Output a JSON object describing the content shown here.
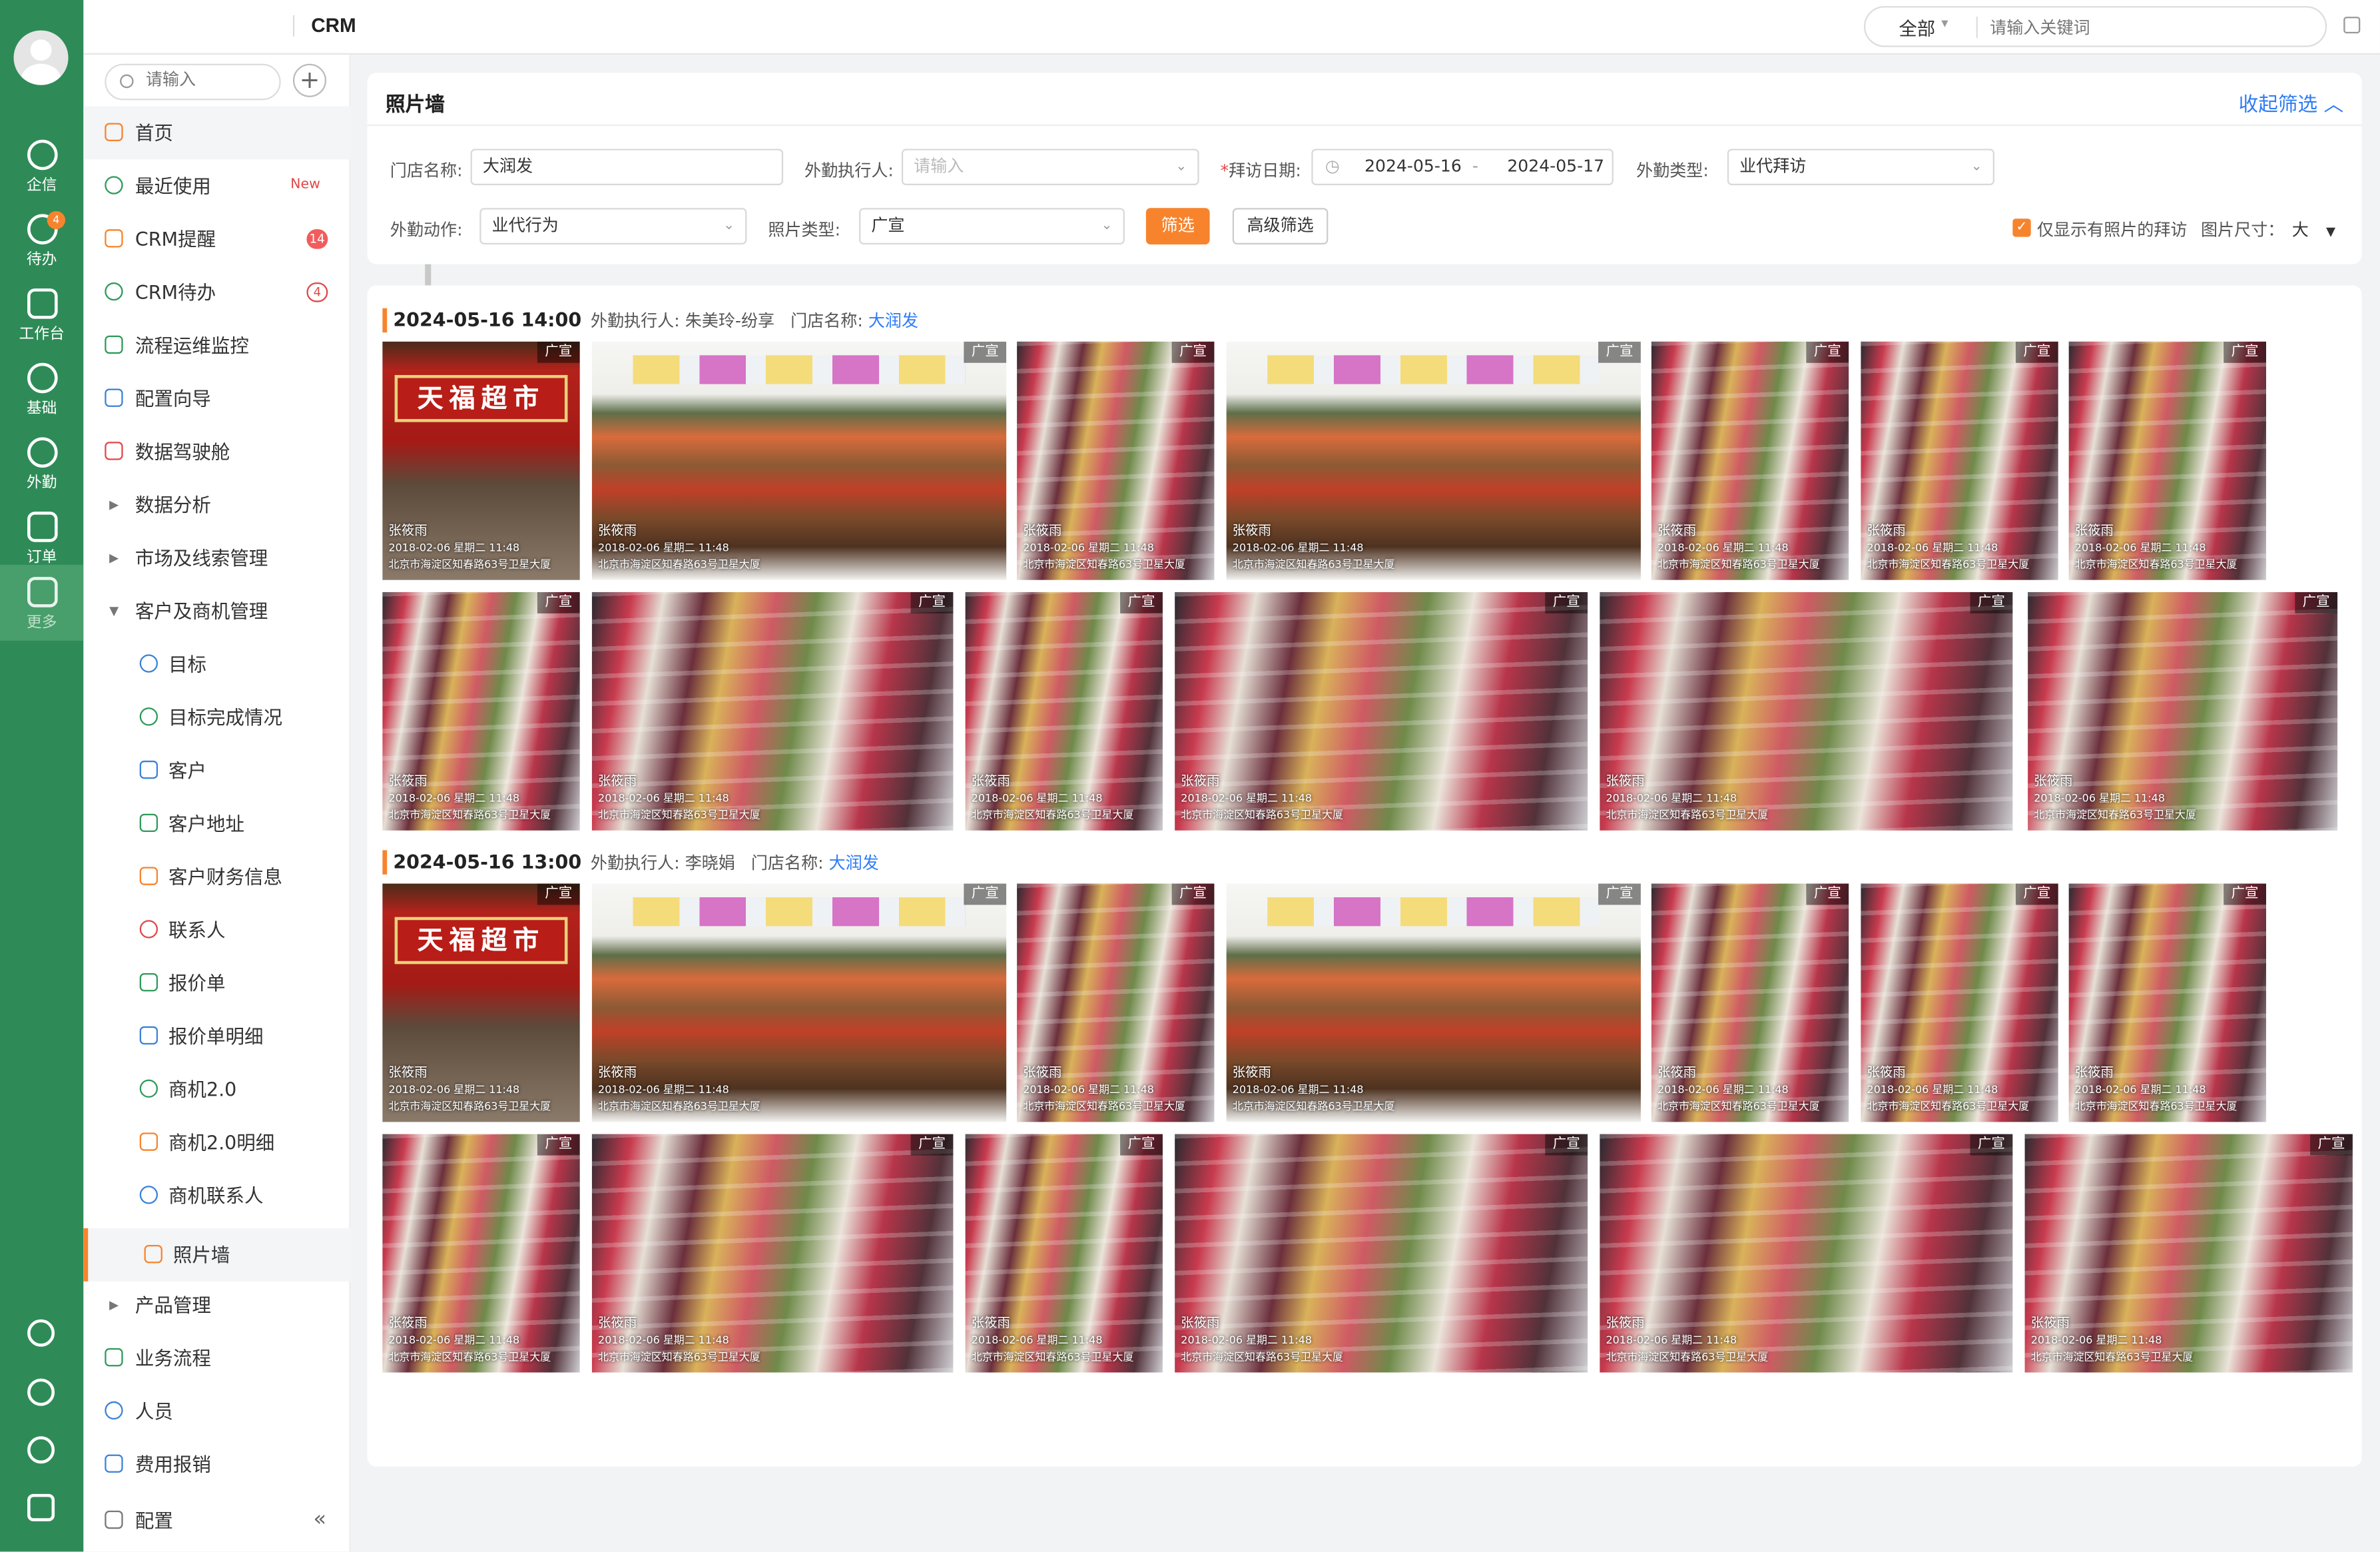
{
  "app": {
    "title": "CRM"
  },
  "rail": {
    "items": [
      {
        "label": "企信",
        "icon": "chat-icon"
      },
      {
        "label": "待办",
        "icon": "todo-icon",
        "badge": "4"
      },
      {
        "label": "工作台",
        "icon": "workbench-icon"
      },
      {
        "label": "基础",
        "icon": "globe-icon"
      },
      {
        "label": "外勤",
        "icon": "location-icon"
      },
      {
        "label": "订单",
        "icon": "order-icon"
      },
      {
        "label": "更多",
        "icon": "grid-icon"
      }
    ],
    "bottom_icons": [
      "help-icon",
      "settings-icon",
      "clock-icon",
      "contacts-icon"
    ]
  },
  "topbar": {
    "scope": "全部",
    "search_placeholder": "请输入关键词"
  },
  "sidebar": {
    "search_placeholder": "请输入",
    "items": [
      {
        "label": "首页",
        "tag": ""
      },
      {
        "label": "最近使用",
        "tag": "New"
      },
      {
        "label": "CRM提醒",
        "count": "14"
      },
      {
        "label": "CRM待办",
        "count": "4"
      },
      {
        "label": "流程运维监控"
      },
      {
        "label": "配置向导"
      },
      {
        "label": "数据驾驶舱"
      },
      {
        "label": "数据分析"
      },
      {
        "label": "市场及线索管理"
      },
      {
        "label": "客户及商机管理"
      },
      {
        "label": "目标"
      },
      {
        "label": "目标完成情况"
      },
      {
        "label": "客户"
      },
      {
        "label": "客户地址"
      },
      {
        "label": "客户财务信息"
      },
      {
        "label": "联系人"
      },
      {
        "label": "报价单"
      },
      {
        "label": "报价单明细"
      },
      {
        "label": "商机2.0"
      },
      {
        "label": "商机2.0明细"
      },
      {
        "label": "商机联系人"
      },
      {
        "label": "照片墙"
      },
      {
        "label": "产品管理"
      },
      {
        "label": "业务流程"
      },
      {
        "label": "人员"
      },
      {
        "label": "费用报销"
      },
      {
        "label": "配置"
      }
    ]
  },
  "filter": {
    "title": "照片墙",
    "toggle": "收起筛选",
    "store_label": "门店名称:",
    "store_value": "大润发",
    "executor_label": "外勤执行人:",
    "executor_placeholder": "请输入",
    "date_label": "拜访日期:",
    "date_start": "2024-05-16",
    "date_sep": "-",
    "date_end": "2024-05-17",
    "type_label": "外勤类型:",
    "type_value": "业代拜访",
    "action_label": "外勤动作:",
    "action_value": "业代行为",
    "photo_type_label": "照片类型:",
    "photo_type_value": "广宣",
    "filter_btn": "筛选",
    "advanced_btn": "高级筛选",
    "only_photos_label": "仅显示有照片的拜访",
    "size_label": "图片尺寸：",
    "size_value": "大"
  },
  "photo_overlay": {
    "tag": "广宣",
    "name": "张筱雨",
    "datetime": "2018-02-06 星期二 11:48",
    "address": "北京市海淀区知春路63号卫星大厦"
  },
  "groups": [
    {
      "datetime": "2024-05-16  14:00",
      "executor_label": "外勤执行人:",
      "executor": "朱美玲-纷享",
      "store_label": "门店名称:",
      "store": "大润发"
    },
    {
      "datetime": "2024-05-16  13:00",
      "executor_label": "外勤执行人:",
      "executor": "李晓娟",
      "store_label": "门店名称:",
      "store": "大润发"
    }
  ],
  "store_sign": "天福超市"
}
